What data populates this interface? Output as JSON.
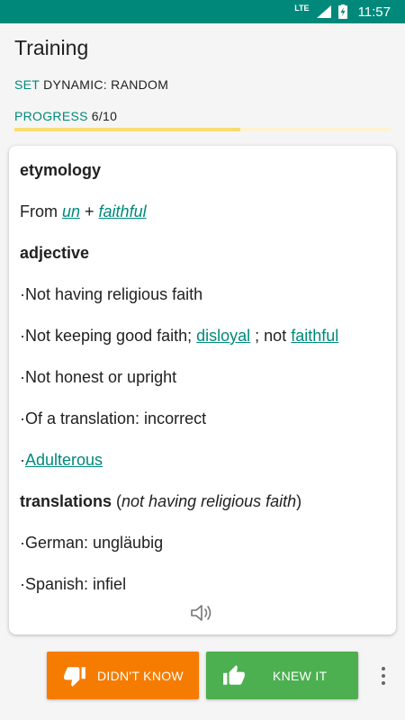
{
  "status_bar": {
    "network": "LTE",
    "time": "11:57"
  },
  "app_bar": {
    "title": "Training"
  },
  "meta": {
    "set_key": "SET",
    "set_value": "DYNAMIC: RANDOM",
    "progress_key": "PROGRESS",
    "progress_value": "6/10",
    "progress_fraction": 0.6
  },
  "card": {
    "etymology_heading": "etymology",
    "etymology": {
      "prefix": "From ",
      "link1": "un",
      "plus": " + ",
      "link2": "faithful"
    },
    "pos_heading": "adjective",
    "def1": "·Not having religious faith",
    "def2": {
      "text": "·Not keeping good faith; ",
      "link1": "disloyal",
      "mid": " ; not ",
      "link2": "faithful"
    },
    "def3": "·Not honest or upright",
    "def4": "·Of a translation: incorrect",
    "def5": {
      "bullet": "·",
      "link": "Adulterous"
    },
    "translations": {
      "heading": "translations",
      "open": " (",
      "note": "not having religious faith",
      "close": ")"
    },
    "tr1": "·German: ungläubig",
    "tr2": "·Spanish: infiel",
    "speaker_icon": "speaker-icon"
  },
  "buttons": {
    "didnt_know": "DIDN'T KNOW",
    "knew_it": "KNEW IT",
    "didnt_icon": "thumbs-down-icon",
    "knew_icon": "thumbs-up-icon"
  },
  "colors": {
    "accent": "#00897b",
    "orange": "#f57c00",
    "green": "#4caf50",
    "progress": "#f9dc72"
  }
}
